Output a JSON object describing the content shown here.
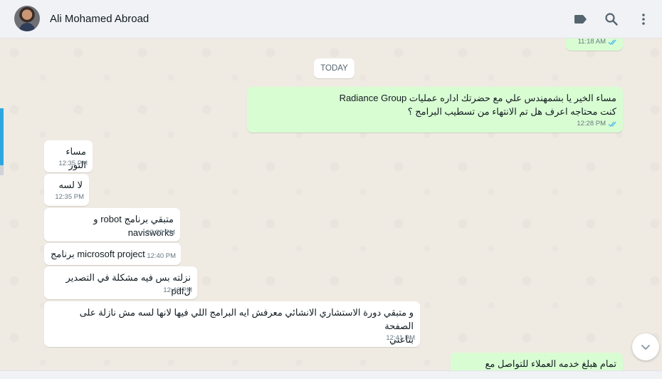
{
  "header": {
    "contact_name": "Ali Mohamed Abroad",
    "icons": [
      "label-icon",
      "search-icon",
      "menu-icon"
    ]
  },
  "day_separator": "TODAY",
  "messages": [
    {
      "direction": "out",
      "text": "",
      "time": "11:18 AM",
      "status": "read"
    },
    {
      "direction": "out",
      "line1": "مساء الخير يا بشمهندس علي مع حضرتك اداره عمليات Radiance Group",
      "line2": "كنت محتاجه اعرف هل تم الانتهاء من تسطيب البرامج ؟",
      "time": "12:28 PM",
      "status": "read"
    },
    {
      "direction": "in",
      "text": "مساء النور",
      "time": "12:35 PM"
    },
    {
      "direction": "in",
      "text": "لا لسه",
      "time": "12:35 PM"
    },
    {
      "direction": "in",
      "text": "متبقي برنامج robot و navisworks",
      "time": "12:39 PM"
    },
    {
      "direction": "in",
      "text": "برنامج microsoft project",
      "time": "12:40 PM"
    },
    {
      "direction": "in",
      "text": "نزلته بس فيه مشكلة في التصدير لpdf",
      "time": "12:40 PM"
    },
    {
      "direction": "in",
      "line1": "و متبقي دورة الاستشاري الانشائي معرفش ايه البرامج اللي فيها لانها لسه مش نازلة على الصفحة",
      "line2": "بتاعتي",
      "time": "12:41 PM"
    },
    {
      "direction": "out",
      "text": "تمام هبلغ خدمه العملاء للتواصل مع حضرتك",
      "time": ""
    }
  ],
  "colors": {
    "outgoing": "#d9fdd3",
    "incoming": "#ffffff",
    "read_ticks": "#53bdeb"
  }
}
